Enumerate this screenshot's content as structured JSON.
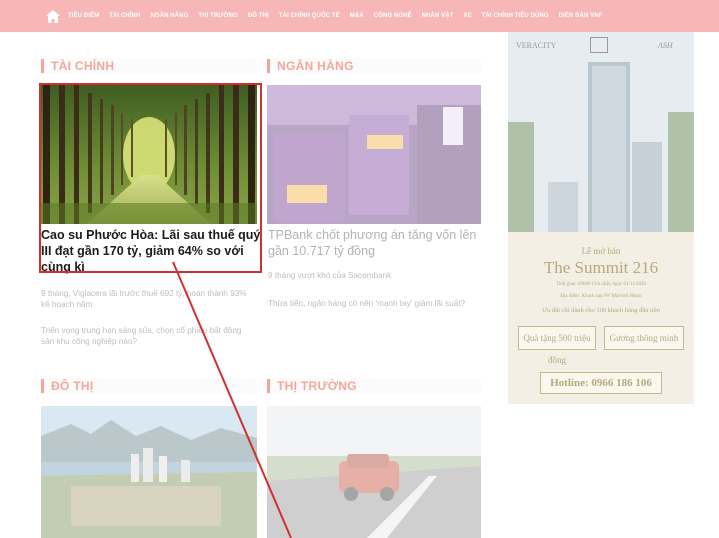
{
  "nav": {
    "items": [
      "TIÊU ĐIỂM",
      "TÀI CHÍNH",
      "NGÂN HÀNG",
      "THỊ TRƯỜNG",
      "ĐÔ THỊ",
      "TÀI CHÍNH QUỐC TẾ",
      "M&A",
      "CÔNG NGHỆ",
      "NHÂN VẬT",
      "XE",
      "TÀI CHÍNH TIÊU DÙNG",
      "DIỄN ĐÀN VNF"
    ],
    "home_icon": "home-icon",
    "bg_color": "#f8b7b7"
  },
  "sections": {
    "tai_chinh": {
      "title": "TÀI CHÍNH",
      "main_title": "Cao su Phước Hòa: Lãi sau thuế quý III đạt gần 170 tỷ, giảm 64% so với cùng kì",
      "items": [
        "9 tháng, Viglacera lãi trước thuế 692 tỷ, hoàn thành 93% kế hoạch năm",
        "Triển vọng trung hạn sáng sủa, chọn cổ phiếu bất động sản khu công nghiệp nào?"
      ]
    },
    "ngan_hang": {
      "title": "NGÂN HÀNG",
      "main_title": "TPBank chốt phương án tăng vốn lên gần 10.717 tỷ đồng",
      "items": [
        "9 tháng vượt khó của Sacombank",
        "Thừa tiền, ngân hàng có nên 'mạnh tay' giảm lãi suất?"
      ]
    },
    "do_thi": {
      "title": "ĐÔ THỊ"
    },
    "thi_truong": {
      "title": "THỊ TRƯỜNG"
    }
  },
  "ad": {
    "logo_left": "VERACITY",
    "logo_right": "ASH",
    "line1": "Lễ mở bán",
    "line2": "The Summit 216",
    "line3": "Thời gian: 09h00 Chủ nhật, ngày 01/11/2020",
    "line4": "Địa điểm: Khách sạn JW Marriott Hanoi",
    "line5": "Ưu đãi chỉ dành cho 100 khách hàng đầu tiên",
    "btn_gift": "Quà tặng 500 triệu đồng",
    "btn_home": "Gương thông minh",
    "hotline": "Hotline: 0966 186 106"
  },
  "colors": {
    "accent": "#f5a49a",
    "highlight_border": "#d23030"
  }
}
